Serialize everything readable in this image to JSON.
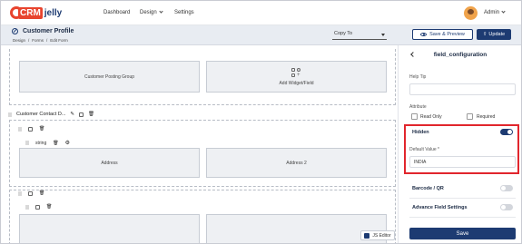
{
  "nav": {
    "logo_crm": "CRM",
    "logo_jelly": "jelly",
    "items": [
      "Dashboard",
      "Design",
      "Settings"
    ],
    "user": "Admin"
  },
  "header": {
    "title": "Customer Profile",
    "breadcrumbs": [
      "Design",
      "/",
      "Forms",
      "/",
      "Edit Form"
    ],
    "copy_to": "Copy To",
    "save_preview": "Save & Preview",
    "update": "Update"
  },
  "canvas": {
    "section1": {
      "field1": "Customer Posting Group",
      "add_widget": "Add Widget/Field"
    },
    "section2": {
      "title": "Customer Contact D...",
      "chip": "string",
      "field1": "Address",
      "field2": "Address 2"
    },
    "js_editor": "JS Editor"
  },
  "panel": {
    "title": "field_configuration",
    "help_tip_label": "Help Tip",
    "attribute_label": "Attribute",
    "read_only_label": "Read Only",
    "required_label": "Required",
    "hidden_label": "Hidden",
    "hidden_on": true,
    "default_value_label": "Default Value *",
    "default_value": "INDIA",
    "barcode_label": "Barcode / QR",
    "barcode_on": false,
    "advanced_label": "Advance Field Settings",
    "advanced_on": false,
    "save": "Save"
  },
  "colors": {
    "brand_navy": "#1d3b72",
    "brand_orange": "#e8442e",
    "highlight_red": "#e1262d"
  }
}
